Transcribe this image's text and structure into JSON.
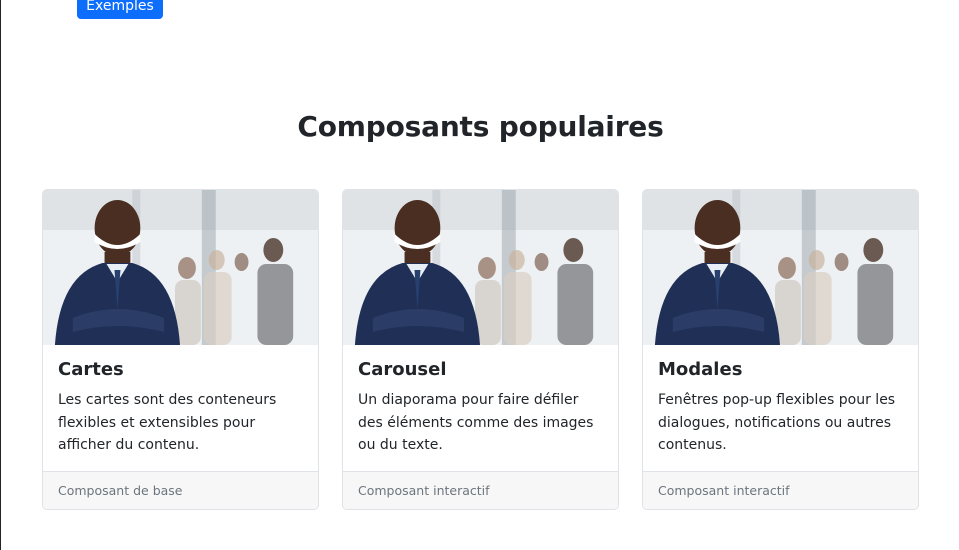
{
  "header": {
    "examples_button": "Exemples"
  },
  "section": {
    "title": "Composants populaires"
  },
  "cards": [
    {
      "title": "Cartes",
      "text": "Les cartes sont des conteneurs flexibles et extensibles pour afficher du contenu.",
      "footer": "Composant de base",
      "image": "businessman-photo"
    },
    {
      "title": "Carousel",
      "text": "Un diaporama pour faire défiler des éléments comme des images ou du texte.",
      "footer": "Composant interactif",
      "image": "businessman-photo"
    },
    {
      "title": "Modales",
      "text": "Fenêtres pop-up flexibles pour les dialogues, notifications ou autres contenus.",
      "footer": "Composant interactif",
      "image": "businessman-photo"
    }
  ],
  "colors": {
    "primary": "#0d6efd",
    "text": "#212529",
    "muted": "#6c757d",
    "footer_bg": "#f7f7f7"
  }
}
